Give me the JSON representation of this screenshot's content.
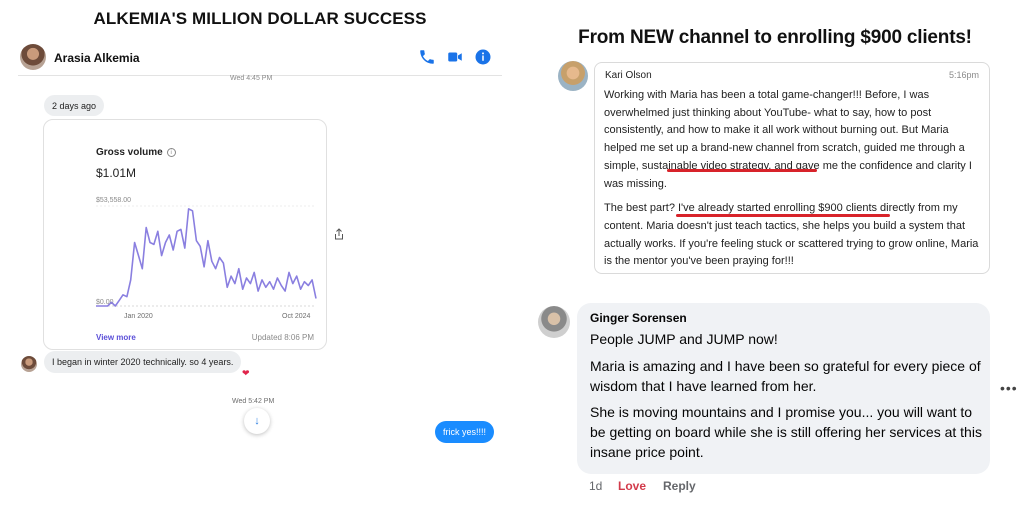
{
  "left": {
    "title": "ALKEMIA'S MILLION DOLLAR SUCCESS",
    "header": {
      "name": "Arasia Alkemia"
    },
    "timestamp_top": "Wed 4:45 PM",
    "day_pill": "2 days ago",
    "card": {
      "label": "Gross volume",
      "value": "$1.01M",
      "y_max_label": "$53,558.00",
      "y_min_label": "$0.00",
      "x_start_label": "Jan 2020",
      "x_end_label": "Oct 2024",
      "view_more": "View more",
      "updated": "Updated 8:06 PM"
    },
    "message_received": "I began in winter 2020 technically. so 4 years.",
    "reaction": "❤",
    "timestamp_bottom": "Wed 5:42 PM",
    "message_sent": "frick yes!!!!",
    "colors": {
      "line": "#8a7fe0",
      "sent_bubble": "#1a8cff",
      "link": "#5b4fd8"
    }
  },
  "chart_data": {
    "type": "line",
    "title": "",
    "xlabel": "",
    "ylabel": "",
    "ylim": [
      0,
      53558
    ],
    "x_ticks": [
      "Jan 2020",
      "Oct 2024"
    ],
    "series": [
      {
        "values": [
          0,
          0,
          0,
          0,
          2000,
          0,
          3000,
          6000,
          5000,
          14000,
          34000,
          27000,
          20000,
          42000,
          34000,
          33000,
          40000,
          27000,
          34000,
          38000,
          30000,
          40000,
          41000,
          31000,
          52000,
          51000,
          35000,
          32000,
          21000,
          35000,
          24000,
          20000,
          26000,
          23000,
          10000,
          16000,
          12000,
          20000,
          9000,
          15000,
          12000,
          18000,
          8000,
          14000,
          10000,
          13000,
          9000,
          15000,
          11000,
          8000,
          18000,
          12000,
          16000,
          9000,
          13000,
          11000,
          14000,
          4000
        ]
      }
    ]
  },
  "right": {
    "title": "From NEW channel to enrolling $900 clients!",
    "kari": {
      "name": "Kari Olson",
      "time": "5:16pm",
      "p1_a": "Working with Maria has been a total game-changer!!! Before, I was overwhelmed just thinking about YouTube- what to say, how to post consistently, and how to make it all work without burning out. But Maria helped me set up a brand-new channel from scratch, guided me through a ",
      "p1_highlight": "simple, sustainable video strategy",
      "p1_b": ", and gave me the confidence and clarity I was missing.",
      "p2_a": "The best part? ",
      "p2_highlight": "I've already started enrolling $900 clients",
      "p2_b": " directly from my content. Maria doesn't just teach tactics, she helps you build a system that actually works. If you're feeling stuck or scattered trying to grow online, Maria is the mentor you've been praying for!!!"
    },
    "ginger": {
      "name": "Ginger Sorensen",
      "line1": "People JUMP and JUMP now!",
      "line2": "Maria is amazing and I have been so grateful for every piece of wisdom that I have learned from her.",
      "line3": "She is moving mountains and I promise you... you will want to be getting on board while she is still offering her services at this insane price point.",
      "age": "1d",
      "love": "Love",
      "reply": "Reply"
    },
    "colors": {
      "underline": "#d8232a",
      "comment_bg": "#f0f2f5",
      "love": "#d23b4b"
    }
  }
}
